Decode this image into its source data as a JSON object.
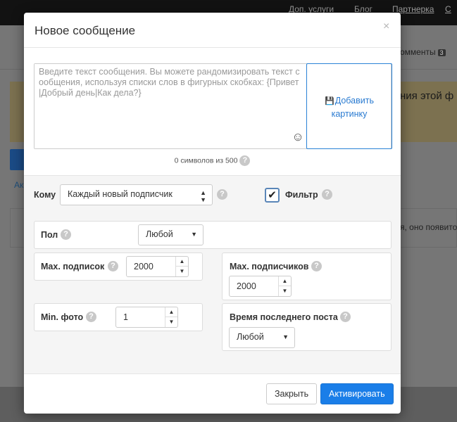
{
  "background": {
    "nav": [
      "Доп. услуги",
      "Блог",
      "Партнерка",
      "С"
    ],
    "tab_label": "омменты",
    "tab_badge": "3",
    "warning_text": "ния этой ф",
    "link_text": "Ак",
    "box_text": "я, оно появито"
  },
  "modal": {
    "title": "Новое сообщение",
    "close_glyph": "×",
    "message": {
      "value": "",
      "placeholder": "Введите текст сообщения. Вы можете рандомизировать текст с ообщения, используя списки слов в фигурных скобках: {Привет |Добрый день|Как дела?}",
      "emoji_glyph": "☺"
    },
    "add_photo": {
      "icon": "💾",
      "label": "Добавить картинку"
    },
    "counter": "0 символов из 500",
    "help_glyph": "?",
    "recipient": {
      "label": "Кому",
      "value": "Каждый новый подписчик"
    },
    "filter": {
      "label": "Фильтр",
      "checked": true,
      "check_glyph": "✔"
    },
    "gender": {
      "label": "Пол",
      "value": "Любой"
    },
    "max_subscriptions": {
      "label": "Max. подписок",
      "value": "2000"
    },
    "max_followers": {
      "label": "Max. подписчиков",
      "value": "2000"
    },
    "min_photos": {
      "label": "Min. фото",
      "value": "1"
    },
    "last_post": {
      "label": "Время последнего поста",
      "value": "Любой"
    },
    "buttons": {
      "close": "Закрыть",
      "activate": "Активировать"
    },
    "colors": {
      "primary": "#1a7ee8",
      "link": "#2a7bd1",
      "help": "#c8c8c8"
    }
  }
}
